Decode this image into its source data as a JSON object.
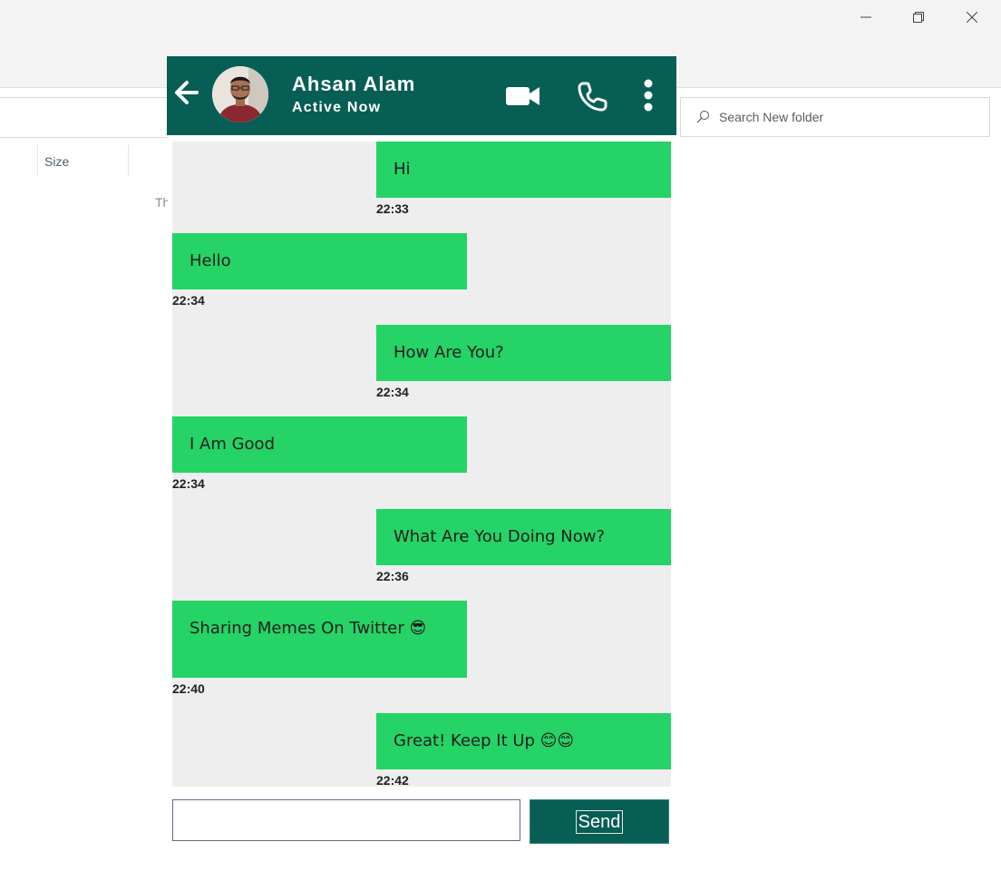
{
  "window": {
    "minimize_icon": "minimize-icon",
    "restore_icon": "restore-icon",
    "close_icon": "close-icon"
  },
  "explorer": {
    "search_placeholder": "Search New folder",
    "column_size": "Size",
    "peek_text": "Th"
  },
  "header": {
    "name": "Ahsan Alam",
    "status": "Active Now",
    "bg_color": "#075e54"
  },
  "messages": [
    {
      "side": "right",
      "text": "Hi",
      "time": "22:33"
    },
    {
      "side": "left",
      "text": "Hello",
      "time": "22:34"
    },
    {
      "side": "right",
      "text": "How Are You?",
      "time": "22:34"
    },
    {
      "side": "left",
      "text": "I Am Good",
      "time": "22:34"
    },
    {
      "side": "right",
      "text": "What Are You Doing Now?",
      "time": "22:36"
    },
    {
      "side": "left",
      "text": "Sharing Memes On Twitter 😎",
      "time": "22:40"
    },
    {
      "side": "right",
      "text": "Great! Keep It Up 😊😊",
      "time": "22:42"
    }
  ],
  "composer": {
    "value": "",
    "send_label": "Send"
  },
  "colors": {
    "bubble": "#25d366",
    "chat_bg": "#eeeeee"
  }
}
